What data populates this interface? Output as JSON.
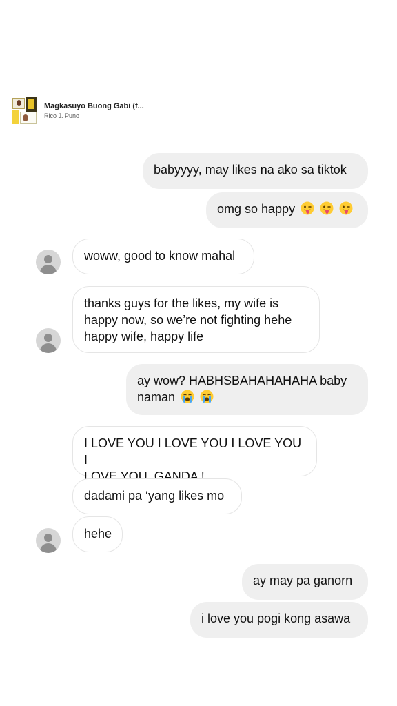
{
  "music": {
    "title": "Magkasuyo Buong Gabi (f...",
    "artist": "Rico J. Puno"
  },
  "messages": [
    {
      "text": "babyyyy, may likes na ako sa tiktok"
    },
    {
      "text": "omg so happy",
      "emoji": [
        "tongue-wink-emoji",
        "tongue-wink-emoji",
        "tongue-wink-emoji"
      ]
    },
    {
      "text": "woww, good to know mahal"
    },
    {
      "lines": [
        "thanks guys for the likes, my wife is",
        "happy now, so we’re not fighting hehe",
        "happy wife, happy life"
      ]
    },
    {
      "lines": [
        "ay wow? HABHSBAHAHAHAHA baby",
        "naman"
      ],
      "emoji": [
        "crying-emoji",
        "crying-emoji"
      ]
    },
    {
      "lines": [
        "I LOVE YOU I LOVE YOU I LOVE YOU I",
        "LOVE YOU, GANDA !"
      ]
    },
    {
      "text": "dadami pa ‘yang likes mo"
    },
    {
      "text": "hehe"
    },
    {
      "text": "ay may pa ganorn"
    },
    {
      "text": "i love you pogi kong asawa"
    }
  ],
  "colors": {
    "sent_bubble": "#efefef",
    "received_border": "#e5e5e5",
    "avatar_bg": "#d6d6d6"
  }
}
